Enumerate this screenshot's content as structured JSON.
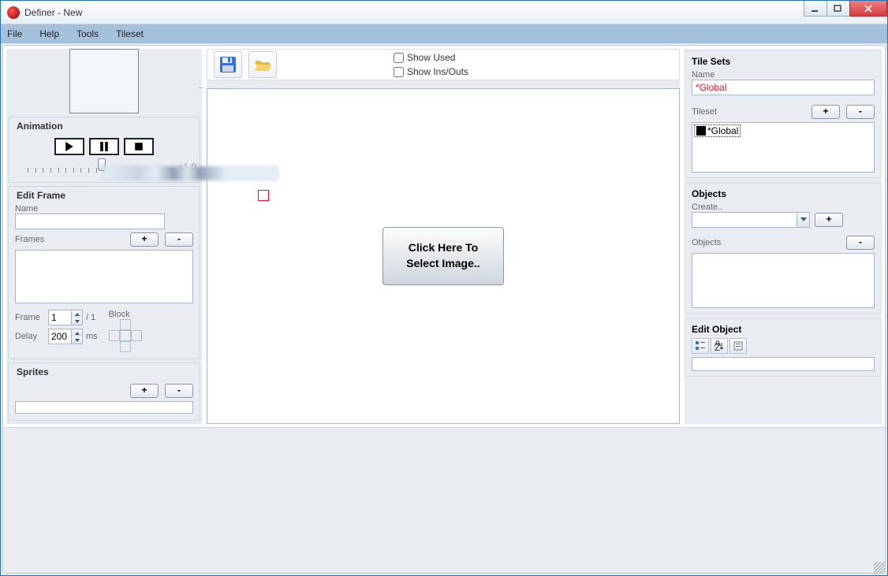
{
  "window": {
    "title": "Definer - New"
  },
  "menu": {
    "file": "File",
    "help": "Help",
    "tools": "Tools",
    "tileset": "Tileset"
  },
  "animation": {
    "title": "Animation",
    "speed_label": "x1.0"
  },
  "editframe": {
    "title": "Edit Frame",
    "name_label": "Name",
    "name_value": "",
    "frames_label": "Frames",
    "plus": "+",
    "minus": "-",
    "frame_label": "Frame",
    "frame_value": "1",
    "frame_total": "/ 1",
    "delay_label": "Delay",
    "delay_value": "200",
    "delay_unit": "ms",
    "block_label": "Block"
  },
  "sprites": {
    "title": "Sprites",
    "plus": "+",
    "minus": "-"
  },
  "center": {
    "show_used": "Show Used",
    "show_ins_outs": "Show Ins/Outs",
    "select_image_btn": "Click Here To\nSelect Image.."
  },
  "tilesets": {
    "title": "Tile Sets",
    "name_label": "Name",
    "name_value": "*Global",
    "tileset_label": "Tileset",
    "plus": "+",
    "minus": "-",
    "item0": "*Global"
  },
  "objects": {
    "title": "Objects",
    "create_label": "Create..",
    "plus": "+",
    "minus": "-",
    "objects_label": "Objects"
  },
  "editobject": {
    "title": "Edit Object"
  }
}
